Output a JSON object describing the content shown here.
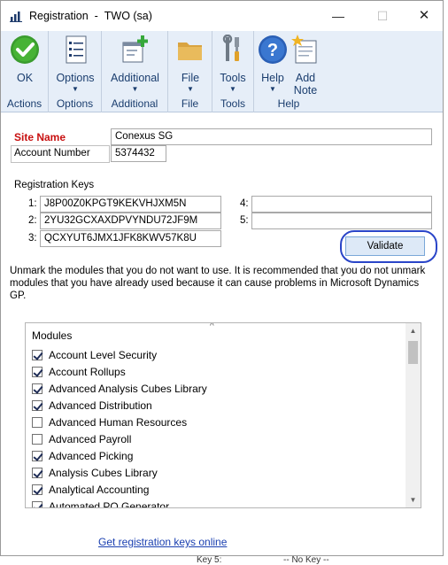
{
  "window": {
    "title": "Registration",
    "company": "TWO (sa)",
    "controls": {
      "minimize": "—",
      "maximize": "☐",
      "close": "✕"
    }
  },
  "ribbon": {
    "groups": [
      {
        "name": "Actions",
        "buttons": [
          {
            "label": "OK",
            "icon": "ok-check-icon"
          }
        ]
      },
      {
        "name": "Options",
        "buttons": [
          {
            "label": "Options",
            "icon": "options-list-icon",
            "dropdown": true
          }
        ]
      },
      {
        "name": "Additional",
        "buttons": [
          {
            "label": "Additional",
            "icon": "additional-window-icon",
            "dropdown": true
          }
        ]
      },
      {
        "name": "File",
        "buttons": [
          {
            "label": "File",
            "icon": "folder-icon",
            "dropdown": true
          }
        ]
      },
      {
        "name": "Tools",
        "buttons": [
          {
            "label": "Tools",
            "icon": "tools-icon",
            "dropdown": true
          }
        ]
      },
      {
        "name": "Help",
        "buttons": [
          {
            "label": "Help",
            "icon": "help-icon",
            "dropdown": true
          },
          {
            "label": "Add\nNote",
            "label_line1": "Add",
            "label_line2": "Note",
            "icon": "add-note-icon"
          }
        ]
      }
    ],
    "dropdown_arrow": "▼"
  },
  "form": {
    "site_name_label": "Site Name",
    "site_name_value": "Conexus SG",
    "account_number_label": "Account Number",
    "account_number_value": "5374432",
    "registration_keys_label": "Registration Keys",
    "keys": [
      {
        "num": "1:",
        "value": "J8P00Z0KPGT9KEKVHJXM5N"
      },
      {
        "num": "2:",
        "value": "2YU32GCXAXDPVYNDU72JF9M"
      },
      {
        "num": "3:",
        "value": "QCXYUT6JMX1JFK8KWV57K8U"
      },
      {
        "num": "4:",
        "value": ""
      },
      {
        "num": "5:",
        "value": ""
      }
    ],
    "validate_label": "Validate",
    "instructions": "Unmark the modules that you do not want to use. It is recommended that you do not unmark modules that you have already used because it can cause problems in Microsoft Dynamics GP."
  },
  "modules": {
    "header": "Modules",
    "sort_glyph": "^",
    "items": [
      {
        "label": "Account Level Security",
        "checked": true
      },
      {
        "label": "Account Rollups",
        "checked": true
      },
      {
        "label": "Advanced Analysis Cubes Library",
        "checked": true
      },
      {
        "label": "Advanced Distribution",
        "checked": true
      },
      {
        "label": "Advanced Human Resources",
        "checked": false
      },
      {
        "label": "Advanced Payroll",
        "checked": false
      },
      {
        "label": "Advanced Picking",
        "checked": true
      },
      {
        "label": "Analysis Cubes Library",
        "checked": true
      },
      {
        "label": "Analytical Accounting",
        "checked": true
      },
      {
        "label": "Automated PO Generator",
        "checked": true
      }
    ],
    "scroll_up": "▲",
    "scroll_down": "▼"
  },
  "footer": {
    "link": "Get registration keys online",
    "behind_text_left": "Key 5:",
    "behind_text_right": "-- No Key --"
  },
  "colors": {
    "ribbon_bg": "#e6eef8",
    "site_name_red": "#c81010",
    "validate_ring": "#2a45c8",
    "link_blue": "#1a3fb0"
  }
}
